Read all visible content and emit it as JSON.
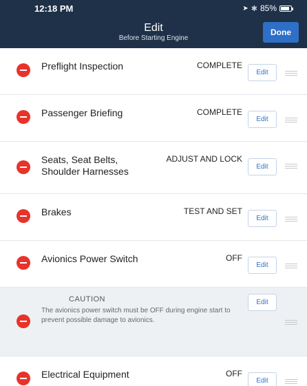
{
  "status": {
    "time": "12:18 PM",
    "battery": "85%",
    "battery_level": 0.85
  },
  "header": {
    "title": "Edit",
    "subtitle": "Before Starting Engine",
    "done_label": "Done"
  },
  "items": [
    {
      "label": "Preflight Inspection",
      "action": "COMPLETE",
      "edit_label": "Edit"
    },
    {
      "label": "Passenger Briefing",
      "action": "COMPLETE",
      "edit_label": "Edit"
    },
    {
      "label_line1": "Seats, Seat Belts,",
      "label_line2": "Shoulder Harnesses",
      "action": "ADJUST AND LOCK",
      "edit_label": "Edit"
    },
    {
      "label": "Brakes",
      "action": "TEST AND SET",
      "edit_label": "Edit"
    },
    {
      "label": "Avionics Power Switch",
      "action": "OFF",
      "edit_label": "Edit"
    },
    {
      "caution_title": "CAUTION",
      "caution_text": "The avionics power switch must be OFF during engine start to prevent possible damage to avionics.",
      "edit_label": "Edit"
    },
    {
      "label": "Electrical Equipment",
      "action": "OFF",
      "edit_label": "Edit"
    }
  ]
}
